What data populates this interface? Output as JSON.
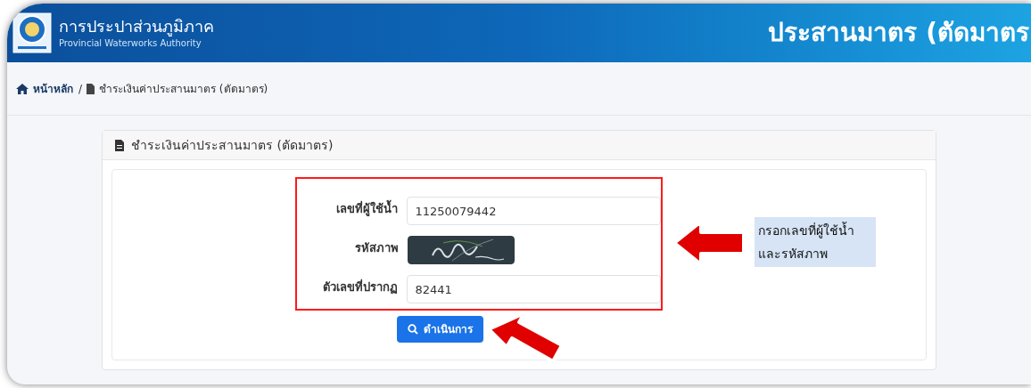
{
  "header": {
    "org_name": "การประปาส่วนภูมิภาค",
    "org_subtitle": "Provincial Waterworks Authority",
    "page_title": "ประสานมาตร (ตัดมาตร"
  },
  "breadcrumb_separator": "/",
  "breadcrumb": [
    {
      "kind": "home",
      "label": "หน้าหลัก"
    },
    {
      "kind": "page",
      "label": "ชำระเงินค่าประสานมาตร (ตัดมาตร)"
    }
  ],
  "card": {
    "title": "ชำระเงินค่าประสานมาตร (ตัดมาตร)",
    "fields": [
      {
        "kind": "input",
        "label": "เลขที่ผู้ใช้น้ำ",
        "value": "11250079442"
      },
      {
        "kind": "captcha",
        "label": "รหัสภาพ"
      },
      {
        "kind": "input",
        "label": "ตัวเลขที่ปรากฏ",
        "value": "82441"
      }
    ],
    "submit": "ดำเนินการ"
  },
  "callout": [
    "กรอกเลขที่ผู้ใช้น้ำ",
    "และรหัสภาพ"
  ]
}
